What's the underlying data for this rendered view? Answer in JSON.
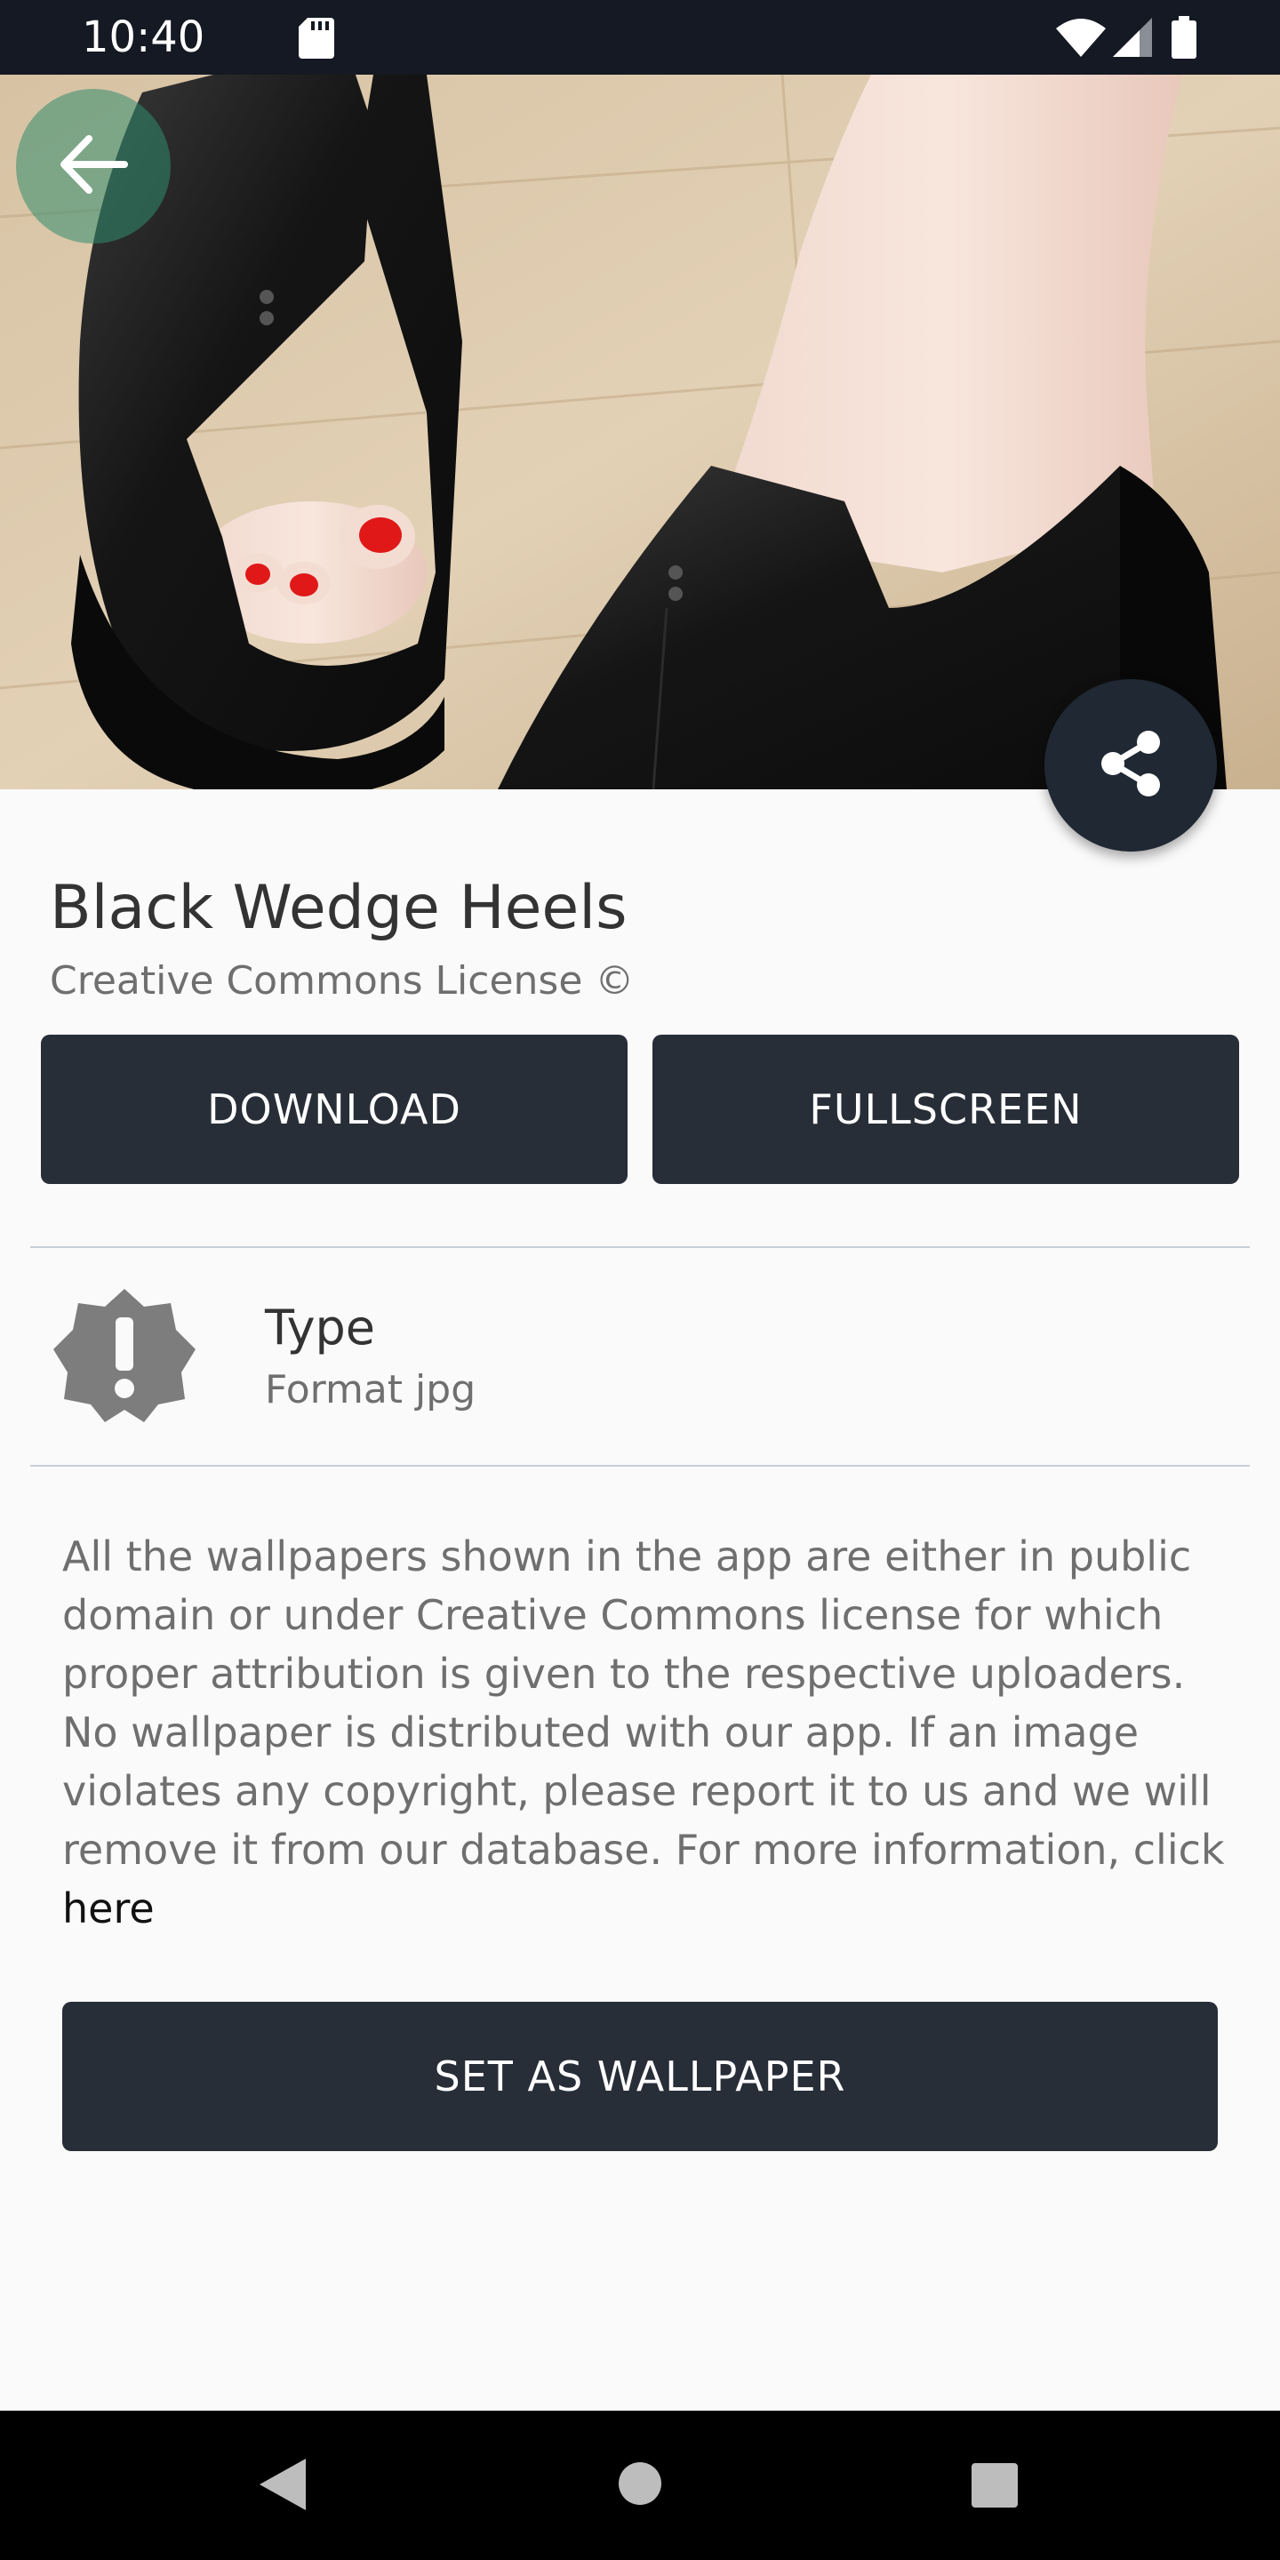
{
  "status_bar": {
    "time": "10:40",
    "icons": [
      "sd-card-icon",
      "wifi-icon",
      "signal-icon",
      "battery-icon"
    ]
  },
  "hero": {
    "image": "black-wedge-heels-photo",
    "back_icon": "arrow-left-icon",
    "share_icon": "share-icon"
  },
  "wallpaper": {
    "title": "Black Wedge Heels",
    "license": "Creative Commons License ©"
  },
  "actions": {
    "download_label": "DOWNLOAD",
    "fullscreen_label": "FULLSCREEN",
    "set_wallpaper_label": "SET AS WALLPAPER"
  },
  "type_info": {
    "icon": "alert-badge-icon",
    "title": "Type",
    "value": "Format jpg"
  },
  "disclaimer": {
    "text": "All the wallpapers shown in the app are either in public domain or under Creative Commons license for which proper attribution is given to the respective uploaders. No wallpaper is distributed with our app. If an image violates any copyright, please report it to us and we will remove it from our database. For more information, click ",
    "link_text": "here"
  },
  "nav_bar": {
    "icons": [
      "nav-back-icon",
      "nav-home-icon",
      "nav-recents-icon"
    ]
  },
  "colors": {
    "status_bar": "#141923",
    "button": "#272e38",
    "fab": "#1f2833",
    "background": "#fafafa",
    "back_button": "#328c6e"
  }
}
